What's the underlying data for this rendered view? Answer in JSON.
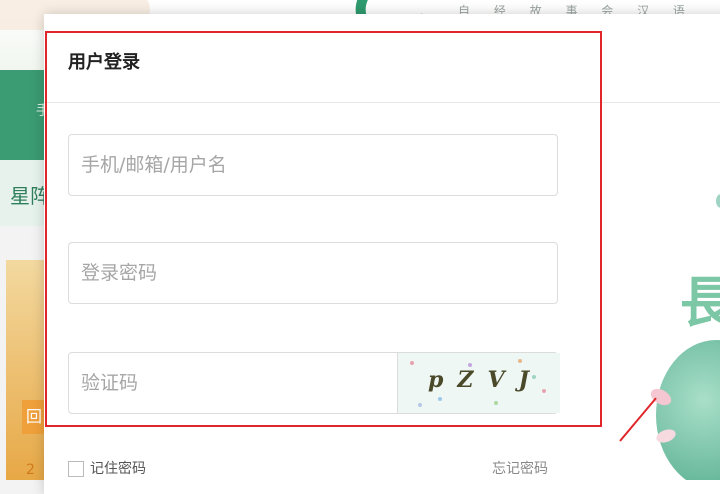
{
  "background": {
    "site_logo_text": "自 经 故 事 会 汉 语",
    "nav_text": "手",
    "section_title": "星阵",
    "left_tag": "回",
    "left_num": "2"
  },
  "modal": {
    "title": "用户登录",
    "fields": {
      "username_placeholder": "手机/邮箱/用户名",
      "password_placeholder": "登录密码",
      "captcha_placeholder": "验证码"
    },
    "captcha_image_text": "pZVJ",
    "remember_label": "记住密码",
    "forgot_label": "忘记密码"
  },
  "illustration": {
    "character": "長"
  },
  "colors": {
    "brand_green": "#3b9b73",
    "highlight_red": "#e0262b"
  }
}
